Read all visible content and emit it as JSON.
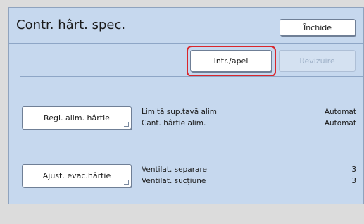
{
  "screen": {
    "title": "Contr. hârt. spec.",
    "close_label": "Închide"
  },
  "toolbar": {
    "intr_apel_label": "Intr./apel",
    "revizuire_label": "Revizuire"
  },
  "sections": [
    {
      "button_label": "Regl. alim. hârtie",
      "rows": [
        {
          "label": "Limită sup.tavă alim",
          "value": "Automat"
        },
        {
          "label": "Cant. hârtie alim.",
          "value": "Automat"
        }
      ]
    },
    {
      "button_label": "Ajust. evac.hârtie",
      "rows": [
        {
          "label": "Ventilat. separare",
          "value": "3"
        },
        {
          "label": "Ventilat. sucțiune",
          "value": "3"
        }
      ]
    }
  ]
}
